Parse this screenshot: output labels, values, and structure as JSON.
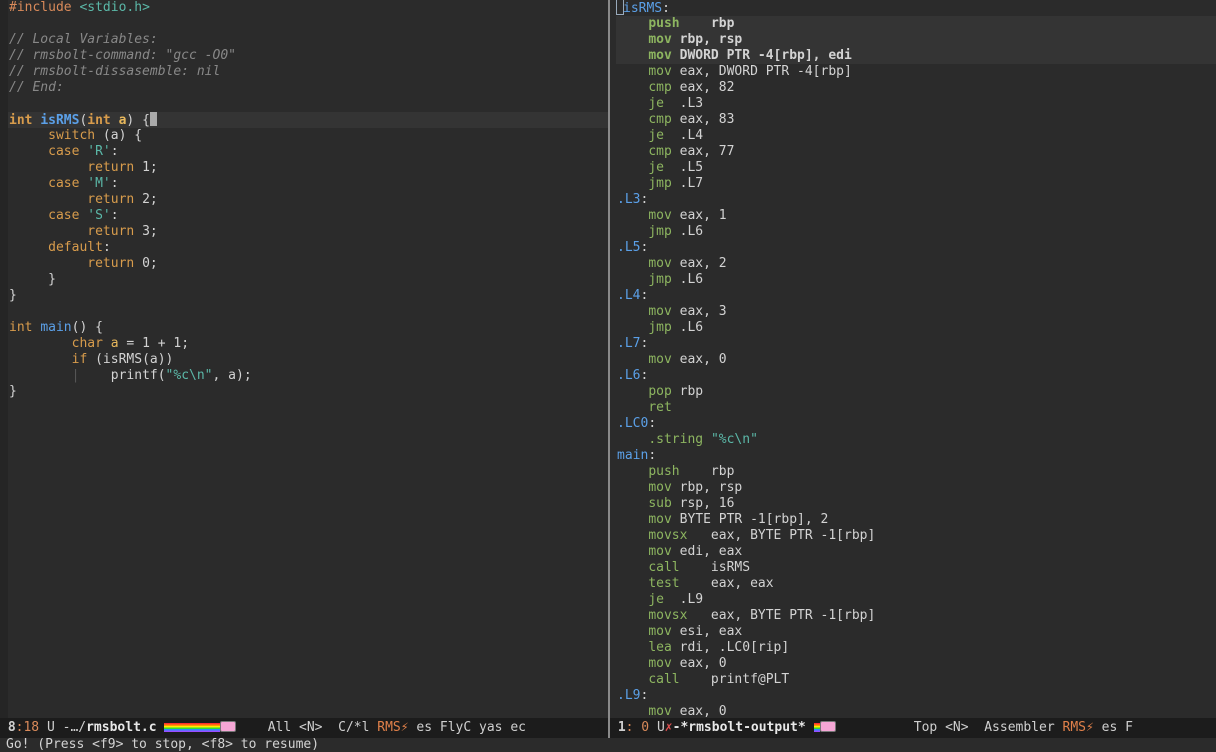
{
  "editor": {
    "left_buffer": {
      "line_01_pp": "#include ",
      "line_01_header": "<stdio.h>",
      "line_03": "// Local Variables:",
      "line_04": "// rmsbolt-command: \"gcc -O0\"",
      "line_05": "// rmsbolt-dissasemble: nil",
      "line_06": "// End:",
      "int_kw": "int",
      "isrms_fn": "isRMS",
      "param_a": "a",
      "switch_kw": "switch",
      "case_kw": "case",
      "return_kw": "return",
      "default_kw": "default",
      "char_kw": "char",
      "if_kw": "if",
      "main_fn": "main",
      "char_R": "'R'",
      "char_M": "'M'",
      "char_S": "'S'",
      "format_str": "\"%c\\n\""
    },
    "right_buffer": {
      "label_isrms": "isRMS",
      "label_l3": ".L3",
      "label_l5": ".L5",
      "label_l4": ".L4",
      "label_l7": ".L7",
      "label_l6": ".L6",
      "label_lc0": ".LC0",
      "label_main": "main",
      "label_l9": ".L9"
    }
  },
  "modeline_left": {
    "position": " 8",
    "column": ":18",
    "state": " U ",
    "filename_prefix": "-…/",
    "filename": "rmsbolt.c",
    "mid": "    All <N>  C/*l ",
    "rms": "RMS",
    "tail": " es FlyC yas ec"
  },
  "modeline_right": {
    "position": " 1",
    "column": ": 0",
    "state": " U",
    "error_marker": "✗",
    "buffer_name": "-*rmsbolt-output*",
    "mid": "          Top <N>  Assembler ",
    "rms": "RMS",
    "tail": " es F"
  },
  "echo_area": {
    "message": "Go! (Press <f9> to stop, <f8> to resume)"
  },
  "colors": {
    "background": "#2b2b2b",
    "keyword": "#d89c4c",
    "function": "#5ba0e8",
    "string": "#5bb8a8",
    "comment": "#888888",
    "instruction": "#8db560"
  }
}
